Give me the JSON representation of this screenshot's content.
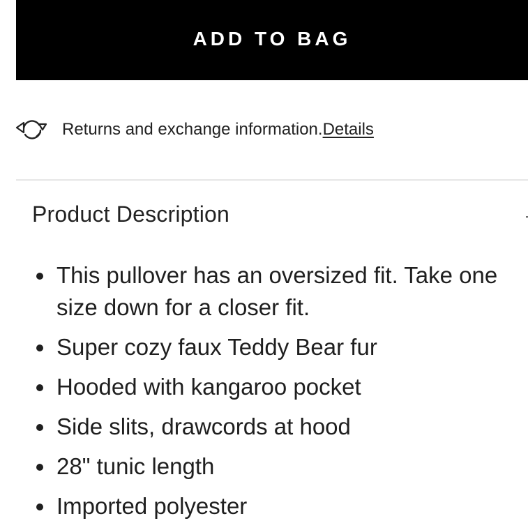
{
  "cta": {
    "add_to_bag_label": "ADD TO BAG"
  },
  "returns": {
    "icon": "returns-exchange-icon",
    "text": "Returns and exchange information.",
    "details_link": "Details"
  },
  "description": {
    "title": "Product Description",
    "bullets": [
      "This pullover has an oversized fit. Take one size down for a closer fit.",
      "Super cozy faux Teddy Bear fur",
      "Hooded with kangaroo pocket",
      "Side slits, drawcords at hood",
      "28\" tunic length",
      "Imported polyester"
    ]
  }
}
